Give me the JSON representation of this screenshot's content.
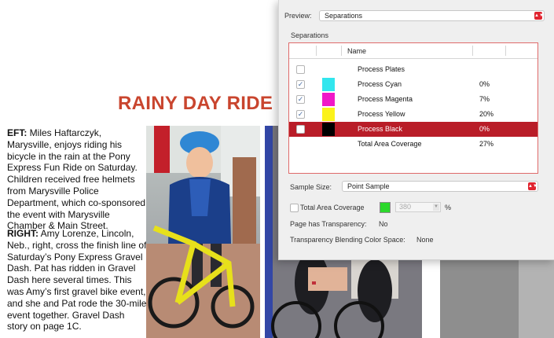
{
  "article": {
    "headline": "RAINY DAY RIDE",
    "caption1_lead": "EFT:",
    "caption1_body": " Miles Haftarczyk, Marysville, enjoys riding his bicycle in the rain at the Pony Express Fun Ride on Saturday. Children received free helmets from Marysville Police Department, which co-sponsored the event with Marysville Chamber & Main Street.",
    "caption2_lead": "RIGHT:",
    "caption2_body": " Amy Lorenze, Lincoln, Neb., right, cross the finish line of Saturday’s Pony Express Gravel Dash. Pat has ridden in Gravel Dash here several times. This was Amy’s first gravel bike event, and she and Pat rode the 30-mile event together. Gravel Dash story on page 1C."
  },
  "panel": {
    "preview_label": "Preview:",
    "preview_value": "Separations",
    "section_title": "Separations",
    "column_name": "Name",
    "rows": [
      {
        "name": "Process Plates",
        "percent": "",
        "checked": false,
        "swatch": "",
        "selected": false
      },
      {
        "name": "Process Cyan",
        "percent": "0%",
        "checked": true,
        "swatch": "#32e6ee",
        "selected": false
      },
      {
        "name": "Process Magenta",
        "percent": "7%",
        "checked": true,
        "swatch": "#f018c8",
        "selected": false
      },
      {
        "name": "Process Yellow",
        "percent": "20%",
        "checked": true,
        "swatch": "#fbf21a",
        "selected": false
      },
      {
        "name": "Process Black",
        "percent": "0%",
        "checked": false,
        "swatch": "#000000",
        "selected": true
      },
      {
        "name": "Total Area Coverage",
        "percent": "27%",
        "checked": false,
        "swatch": "",
        "selected": false,
        "no_checkbox": true
      }
    ],
    "sample_size_label": "Sample Size:",
    "sample_size_value": "Point Sample",
    "tac_label": "Total Area Coverage",
    "tac_value": "380",
    "tac_unit": "%",
    "transparency_label": "Page has Transparency:",
    "transparency_value": "No",
    "blending_label": "Transparency Blending Color Space:",
    "blending_value": "None",
    "accent_color": "#b91d28",
    "swatch_color": "#2bd82b"
  }
}
